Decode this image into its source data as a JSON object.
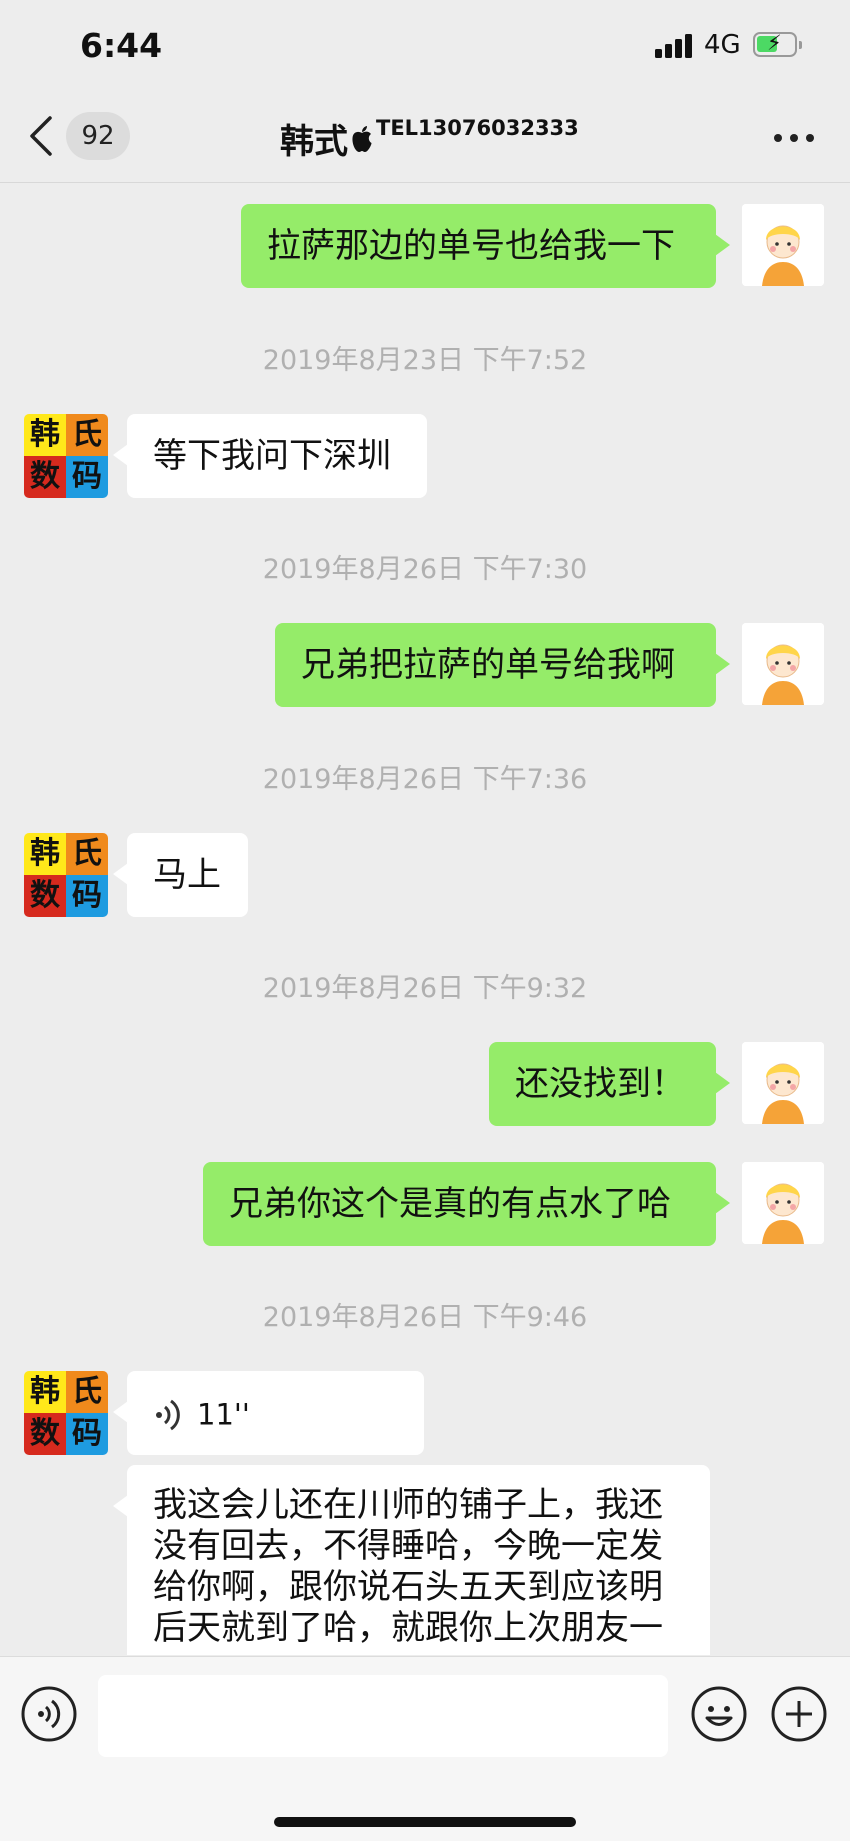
{
  "status_bar": {
    "time": "6:44",
    "network": "4G"
  },
  "nav": {
    "unread_count": "92",
    "contact_name": "韩式",
    "contact_tel": "TEL13076032333"
  },
  "messages": [
    {
      "type": "text",
      "side": "me",
      "text": "拉萨那边的单号也给我一下"
    },
    {
      "type": "timestamp",
      "text": "2019年8月23日 下午7:52"
    },
    {
      "type": "text",
      "side": "them",
      "text": "等下我问下深圳"
    },
    {
      "type": "timestamp",
      "text": "2019年8月26日 下午7:30"
    },
    {
      "type": "text",
      "side": "me",
      "text": "兄弟把拉萨的单号给我啊"
    },
    {
      "type": "timestamp",
      "text": "2019年8月26日 下午7:36"
    },
    {
      "type": "text",
      "side": "them",
      "text": "马上"
    },
    {
      "type": "timestamp",
      "text": "2019年8月26日 下午9:32"
    },
    {
      "type": "text",
      "side": "me",
      "text": "还没找到！"
    },
    {
      "type": "text",
      "side": "me",
      "text": "兄弟你这个是真的有点水了哈"
    },
    {
      "type": "timestamp",
      "text": "2019年8月26日 下午9:46"
    },
    {
      "type": "voice",
      "side": "them",
      "duration": "11''"
    },
    {
      "type": "text",
      "side": "them",
      "text": "我这会儿还在川师的铺子上，我还没有回去，不得睡哈，今晚一定发给你啊，跟你说石头五天到应该明后天就到了哈，就跟你上次朋友一"
    }
  ],
  "contact_avatar": {
    "chars": [
      "韩",
      "氏",
      "数",
      "码"
    ],
    "colors": [
      "#ffe81a",
      "#f08a1c",
      "#d62a1e",
      "#1e9be0"
    ]
  },
  "colors": {
    "my_bubble": "#95ec69",
    "their_bubble": "#ffffff",
    "background": "#ededed",
    "timestamp": "#b0b0b0"
  },
  "icons": {
    "back": "chevron-left-icon",
    "more": "more-dots-icon",
    "voice_input": "voice-icon",
    "emoji": "emoji-icon",
    "plus": "plus-icon"
  }
}
